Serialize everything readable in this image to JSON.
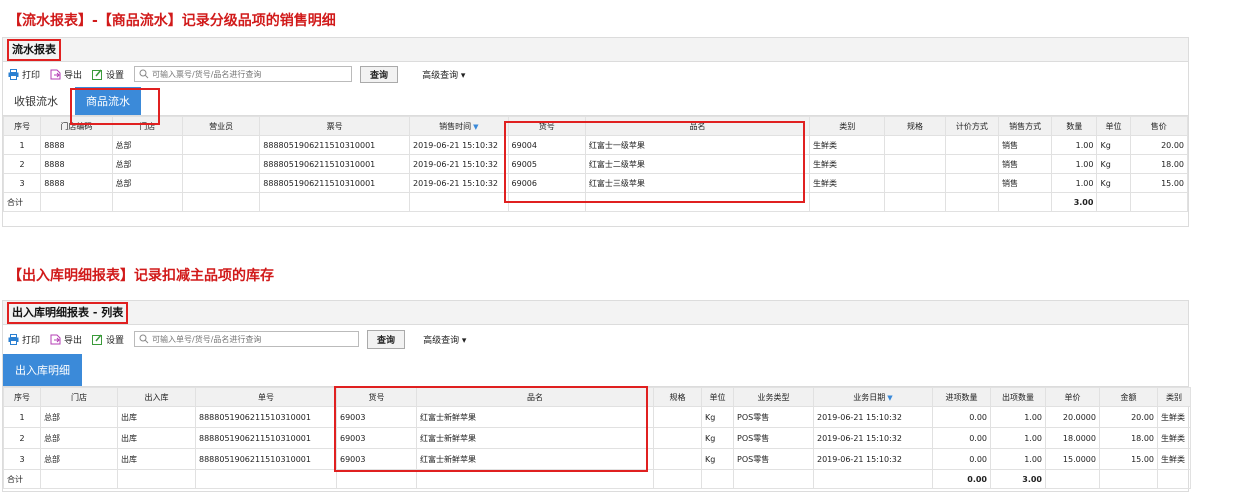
{
  "headings": {
    "top": "【流水报表】-【商品流水】记录分级品项的销售明细",
    "bottom": "【出入库明细报表】记录扣减主品项的库存"
  },
  "toolbar": {
    "print": "打印",
    "export": "导出",
    "settings": "设置",
    "query": "查询",
    "advanced": "高级查询 ▾"
  },
  "panel1": {
    "title": "流水报表",
    "search_placeholder": "可输入票号/货号/品名进行查询",
    "tabs": [
      {
        "label": "收银流水",
        "active": false
      },
      {
        "label": "商品流水",
        "active": true
      }
    ],
    "columns": [
      "序号",
      "门店编码",
      "门店",
      "营业员",
      "票号",
      "销售时间",
      "货号",
      "品名",
      "类别",
      "规格",
      "计价方式",
      "销售方式",
      "数量",
      "单位",
      "售价"
    ],
    "sort_column": "销售时间",
    "rows": [
      [
        "1",
        "8888",
        "总部",
        "",
        "8888051906211510310001",
        "2019-06-21 15:10:32",
        "69004",
        "红富士一级苹果",
        "生鲜类",
        "",
        "",
        "销售",
        "1.00",
        "Kg",
        "20.00"
      ],
      [
        "2",
        "8888",
        "总部",
        "",
        "8888051906211510310001",
        "2019-06-21 15:10:32",
        "69005",
        "红富士二级苹果",
        "生鲜类",
        "",
        "",
        "销售",
        "1.00",
        "Kg",
        "18.00"
      ],
      [
        "3",
        "8888",
        "总部",
        "",
        "8888051906211510310001",
        "2019-06-21 15:10:32",
        "69006",
        "红富士三级苹果",
        "生鲜类",
        "",
        "",
        "销售",
        "1.00",
        "Kg",
        "15.00"
      ]
    ],
    "summary_label": "合计",
    "summary_qty": "3.00"
  },
  "panel2": {
    "title": "出入库明细报表 - 列表",
    "search_placeholder": "可输入单号/货号/品名进行查询",
    "tabs": [
      {
        "label": "出入库明细",
        "active": true
      }
    ],
    "columns": [
      "序号",
      "门店",
      "出入库",
      "单号",
      "货号",
      "品名",
      "规格",
      "单位",
      "业务类型",
      "业务日期",
      "进项数量",
      "出项数量",
      "单价",
      "金额",
      "类别"
    ],
    "sort_column": "业务日期",
    "rows": [
      [
        "1",
        "总部",
        "出库",
        "8888051906211510310001",
        "69003",
        "红富士新鲜苹果",
        "",
        "Kg",
        "POS零售",
        "2019-06-21 15:10:32",
        "0.00",
        "1.00",
        "20.0000",
        "20.00",
        "生鲜类"
      ],
      [
        "2",
        "总部",
        "出库",
        "8888051906211510310001",
        "69003",
        "红富士新鲜苹果",
        "",
        "Kg",
        "POS零售",
        "2019-06-21 15:10:32",
        "0.00",
        "1.00",
        "18.0000",
        "18.00",
        "生鲜类"
      ],
      [
        "3",
        "总部",
        "出库",
        "8888051906211510310001",
        "69003",
        "红富士新鲜苹果",
        "",
        "Kg",
        "POS零售",
        "2019-06-21 15:10:32",
        "0.00",
        "1.00",
        "15.0000",
        "15.00",
        "生鲜类"
      ]
    ],
    "summary_label": "合计",
    "summary_in": "0.00",
    "summary_out": "3.00"
  }
}
